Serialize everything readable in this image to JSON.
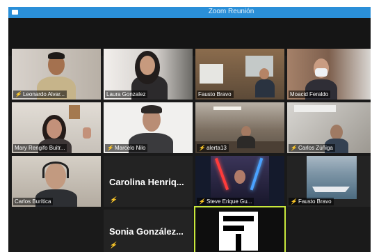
{
  "window": {
    "title": "Zoom Reunión"
  },
  "participants": {
    "p1": {
      "name": "Leonardo Alvar..."
    },
    "p2": {
      "name": "Laura Gonzalez"
    },
    "p3": {
      "name": "Fausto Bravo"
    },
    "p4": {
      "name": "Moacid Feraldo"
    },
    "p5": {
      "name": "Mary Rengifo Buitr..."
    },
    "p6": {
      "name": "Marcelo Nilo"
    },
    "p7": {
      "name": "alerta13"
    },
    "p8": {
      "name": "Carlos Zúñiga"
    },
    "p9": {
      "name": "Carlos Burítica"
    },
    "p10": {
      "name": "Carolina Henriq..."
    },
    "p11": {
      "name": "Steve Erique Gu..."
    },
    "p12": {
      "name": "Fausto Bravo"
    },
    "p13": {
      "name": "Sonia González..."
    }
  },
  "icons": {
    "muted_mic": "muted-mic-icon",
    "app": "zoom-app-icon"
  },
  "colors": {
    "titlebar": "#2a8fd8",
    "active_speaker": "#c8e83c",
    "muted": "#e0433a"
  }
}
